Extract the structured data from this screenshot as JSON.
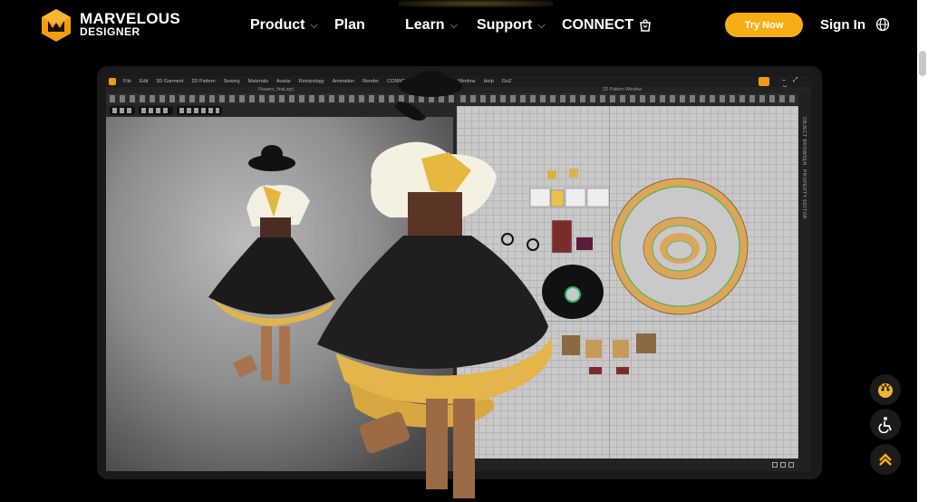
{
  "brand": {
    "line1": "MARVELOUS",
    "line2": "DESIGNER",
    "accent": "#f7ad14"
  },
  "nav": {
    "items": [
      {
        "label": "Product",
        "has_dropdown": true
      },
      {
        "label": "Plan",
        "has_dropdown": false
      },
      {
        "label": "Learn",
        "has_dropdown": true
      },
      {
        "label": "Support",
        "has_dropdown": true
      },
      {
        "label": "CONNECT",
        "has_dropdown": false,
        "icon": "shopping-bag-icon"
      }
    ],
    "dropdown_glyph": "⌵",
    "try_now": "Try Now",
    "sign_in": "Sign In",
    "language_icon": "globe-icon"
  },
  "app": {
    "menu": [
      "File",
      "Edit",
      "3D Garment",
      "2D Pattern",
      "Sewing",
      "Materials",
      "Avatar",
      "Retopology",
      "Animation",
      "Render",
      "CONNECT",
      "S",
      "Settings",
      "Window",
      "Help",
      "GoZ"
    ],
    "window_controls": "– ⤢ ✕",
    "file_title": "Flowers_final.zprj",
    "pattern_title": "2D Pattern Window",
    "side_labels": [
      "OBJECT BROWSER",
      "PROPERTY EDITOR"
    ]
  },
  "floating": {
    "assistant_icon": "assistant-avatar-icon",
    "accessibility_icon": "accessibility-icon",
    "scroll_top_icon": "chevron-up-icon"
  }
}
